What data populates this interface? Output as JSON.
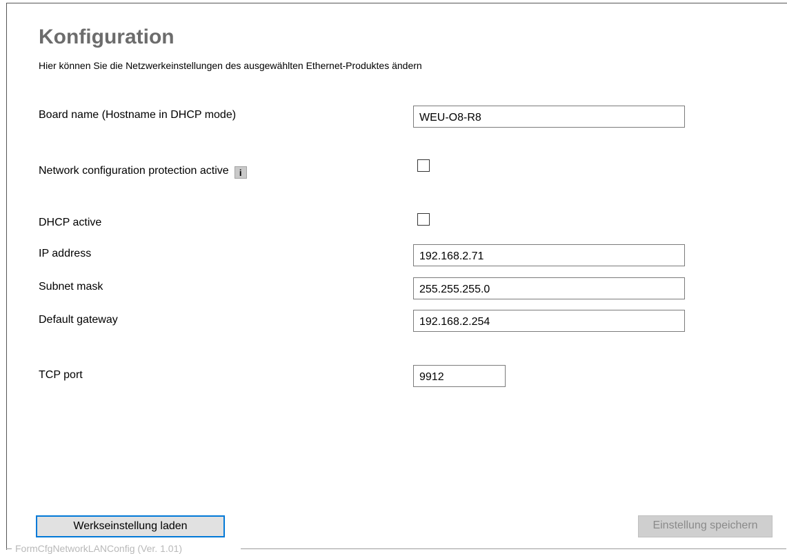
{
  "header": {
    "title": "Konfiguration",
    "subtitle": "Hier können Sie die Netzwerkeinstellungen des ausgewählten Ethernet-Produktes ändern"
  },
  "form": {
    "board_name": {
      "label": "Board name (Hostname in DHCP mode)",
      "value": "WEU-O8-R8"
    },
    "protection": {
      "label": "Network configuration protection active",
      "info_glyph": "i",
      "checked": false
    },
    "dhcp": {
      "label": "DHCP active",
      "checked": false
    },
    "ip": {
      "label": "IP address",
      "value": "192.168.2.71"
    },
    "subnet": {
      "label": "Subnet mask",
      "value": "255.255.255.0"
    },
    "gateway": {
      "label": "Default gateway",
      "value": "192.168.2.254"
    },
    "tcp_port": {
      "label": "TCP port",
      "value": "9912"
    }
  },
  "buttons": {
    "factory_label": "Werkseinstellung laden",
    "save_label": "Einstellung speichern",
    "save_enabled": false
  },
  "frame_caption": "FormCfgNetworkLANConfig (Ver. 1.01)",
  "colors": {
    "focus_border": "#0078d7",
    "title": "#6c6c6c"
  }
}
